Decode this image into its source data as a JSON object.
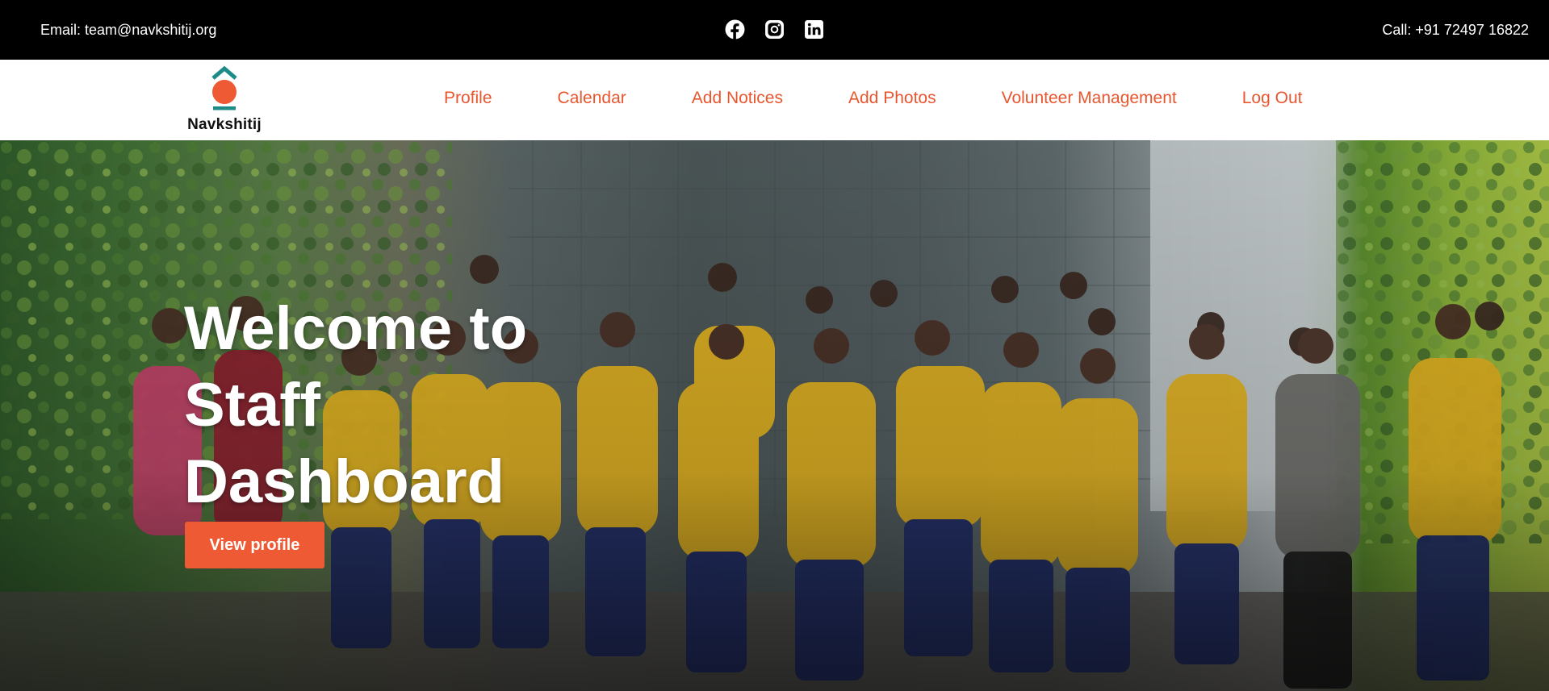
{
  "topbar": {
    "email": "Email: team@navkshitij.org",
    "call": "Call: +91 72497 16822",
    "socials": [
      {
        "icon": "facebook-icon"
      },
      {
        "icon": "instagram-icon"
      },
      {
        "icon": "linkedin-icon"
      }
    ]
  },
  "brand": {
    "name": "Navkshitij",
    "colors": {
      "teal": "#1d8b87",
      "orange": "#ee5a33"
    }
  },
  "nav": {
    "items": [
      {
        "label": "Profile"
      },
      {
        "label": "Calendar"
      },
      {
        "label": "Add Notices"
      },
      {
        "label": "Add Photos"
      },
      {
        "label": "Volunteer Management"
      },
      {
        "label": "Log Out"
      }
    ],
    "link_color": "#e8562f"
  },
  "hero": {
    "title": "Welcome to Staff Dashboard",
    "button_label": "View profile",
    "button_color": "#ee5a33",
    "background_image": "group-photo"
  }
}
